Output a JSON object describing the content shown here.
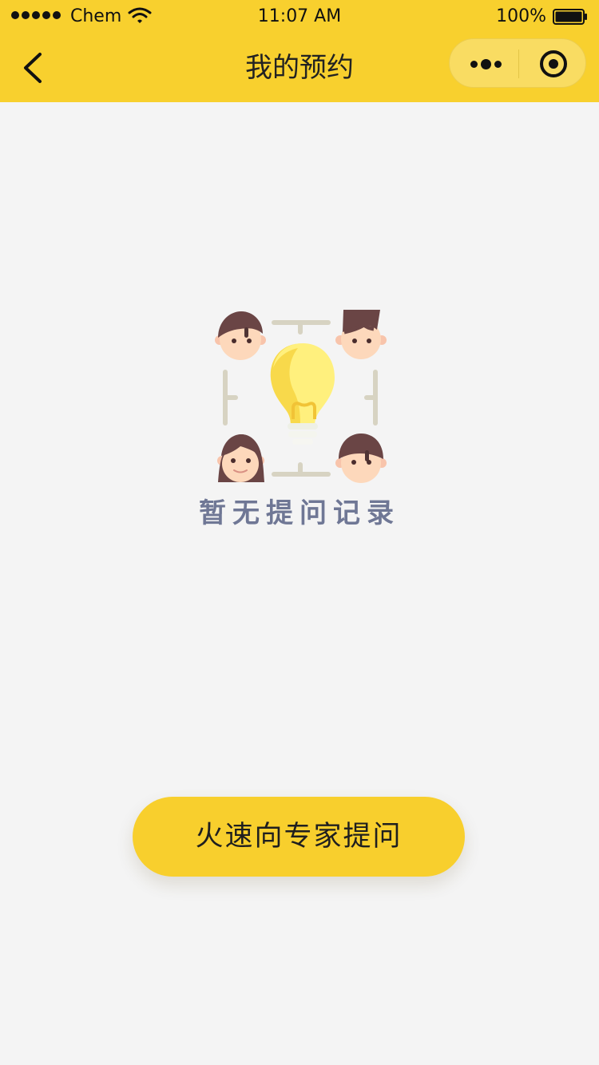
{
  "status_bar": {
    "carrier": "Chem",
    "time": "11:07 AM",
    "battery": "100%"
  },
  "nav": {
    "title": "我的预约"
  },
  "empty_state": {
    "message": "暂无提问记录"
  },
  "action": {
    "label": "火速向专家提问"
  },
  "colors": {
    "brand": "#f8d02e",
    "background": "#f4f4f4",
    "button": "#f8cf2d",
    "empty_text": "#6f7795"
  },
  "icons": {
    "back": "chevron-left-icon",
    "more": "more-dots-icon",
    "close": "target-circle-icon",
    "wifi": "wifi-icon",
    "battery": "battery-icon",
    "illustration": "lightbulb-team-illustration"
  }
}
